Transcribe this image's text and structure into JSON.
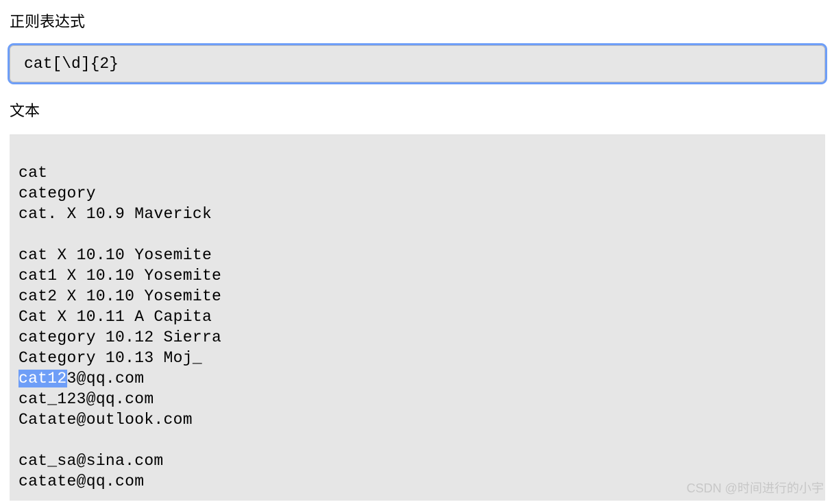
{
  "labels": {
    "regex": "正则表达式",
    "text": "文本"
  },
  "regex": {
    "value": "cat[\\d]{2}"
  },
  "textContent": {
    "lines": [
      "cat",
      "category",
      "cat. X 10.9 Maverick",
      "",
      "cat X 10.10 Yosemite",
      "cat1 X 10.10 Yosemite",
      "cat2 X 10.10 Yosemite",
      "Cat X 10.11 A Capita",
      "category 10.12 Sierra",
      "Category 10.13 Moj_",
      "cat123@qq.com",
      "cat_123@qq.com",
      "Catate@outlook.com",
      "",
      "cat_sa@sina.com",
      "catate@qq.com"
    ],
    "highlights": [
      {
        "lineIndex": 10,
        "start": 0,
        "end": 5
      }
    ]
  },
  "watermark": "CSDN @时间进行的小宇"
}
